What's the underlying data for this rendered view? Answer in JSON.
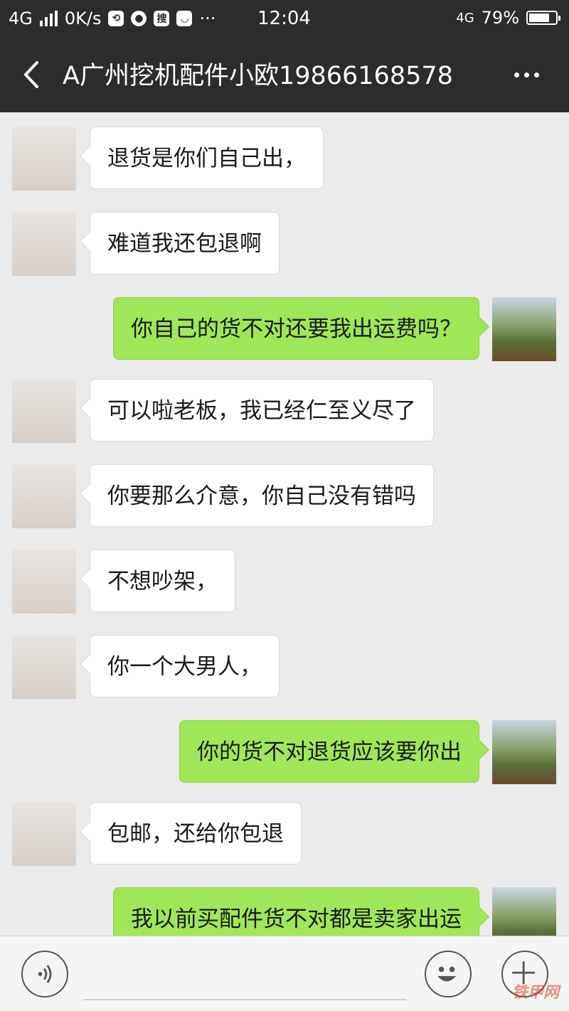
{
  "status_bar": {
    "network": "4G",
    "speed": "0K/s",
    "search_badge": "搜",
    "time": "12:04",
    "network_right": "4G",
    "battery": "79%",
    "battery_level": 0.79
  },
  "header": {
    "title": "A广州挖机配件小欧19866168578"
  },
  "messages": [
    {
      "side": "in",
      "text": "退货是你们自己出，"
    },
    {
      "side": "in",
      "text": "难道我还包退啊"
    },
    {
      "side": "out",
      "text": "你自己的货不对还要我出运费吗？"
    },
    {
      "side": "in",
      "text": "可以啦老板，我已经仁至义尽了"
    },
    {
      "side": "in",
      "text": "你要那么介意，你自己没有错吗"
    },
    {
      "side": "in",
      "text": "不想吵架，"
    },
    {
      "side": "in",
      "text": "你一个大男人，"
    },
    {
      "side": "out",
      "text": "你的货不对退货应该要你出"
    },
    {
      "side": "in",
      "text": "包邮，还给你包退"
    },
    {
      "side": "out",
      "text": "我以前买配件货不对都是卖家出运"
    }
  ],
  "input": {
    "value": ""
  },
  "watermark": "铁甲网"
}
